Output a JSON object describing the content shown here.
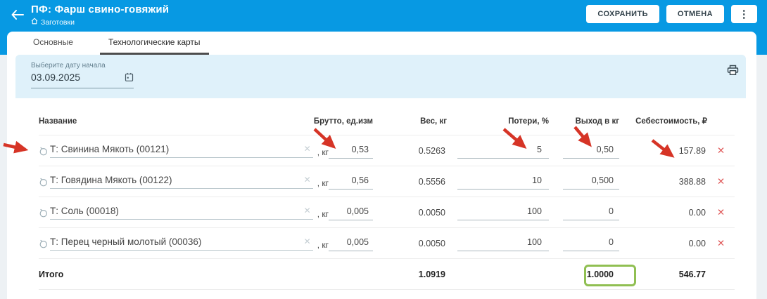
{
  "app": {
    "title": "ПФ: Фарш свино-говяжий",
    "breadcrumb": "Заготовки",
    "actions": {
      "save": "СОХРАНИТЬ",
      "cancel": "ОТМЕНА"
    }
  },
  "tabs": {
    "main": "Основные",
    "tech_cards": "Технологические карты"
  },
  "filters": {
    "date_label": "Выберите дату начала",
    "date_value": "03.09.2025"
  },
  "table": {
    "headers": {
      "name": "Название",
      "gross": "Брутто, ед.изм",
      "weight": "Вес, кг",
      "loss": "Потери, %",
      "output": "Выход в кг",
      "cost": "Себестоимость, ₽"
    },
    "rows": [
      {
        "name": "Т: Свинина Мякоть (00121)",
        "unit": ", кг",
        "gross": "0,53",
        "weight": "0.5263",
        "loss": "5",
        "output": "0,50",
        "cost": "157.89"
      },
      {
        "name": "Т: Говядина Мякоть (00122)",
        "unit": ", кг",
        "gross": "0,56",
        "weight": "0.5556",
        "loss": "10",
        "output": "0,500",
        "cost": "388.88"
      },
      {
        "name": "Т: Соль (00018)",
        "unit": ", кг",
        "gross": "0,005",
        "weight": "0.0050",
        "loss": "100",
        "output": "0",
        "cost": "0.00"
      },
      {
        "name": "Т: Перец черный молотый (00036)",
        "unit": ", кг",
        "gross": "0,005",
        "weight": "0.0050",
        "loss": "100",
        "output": "0",
        "cost": "0.00"
      }
    ],
    "total": {
      "label": "Итого",
      "weight": "1.0919",
      "output": "1.0000",
      "cost": "546.77"
    }
  },
  "icons": {
    "kebab": "⋮",
    "clear": "✕",
    "delete": "✕"
  },
  "colors": {
    "header_blue": "#0799e3",
    "panel_blue": "#dff1fa",
    "tab_underline": "#4d4d4d",
    "annotation_arrow_red": "#d63426",
    "annotation_highlight_green": "#90bf52",
    "delete_red": "#e05c5c"
  }
}
